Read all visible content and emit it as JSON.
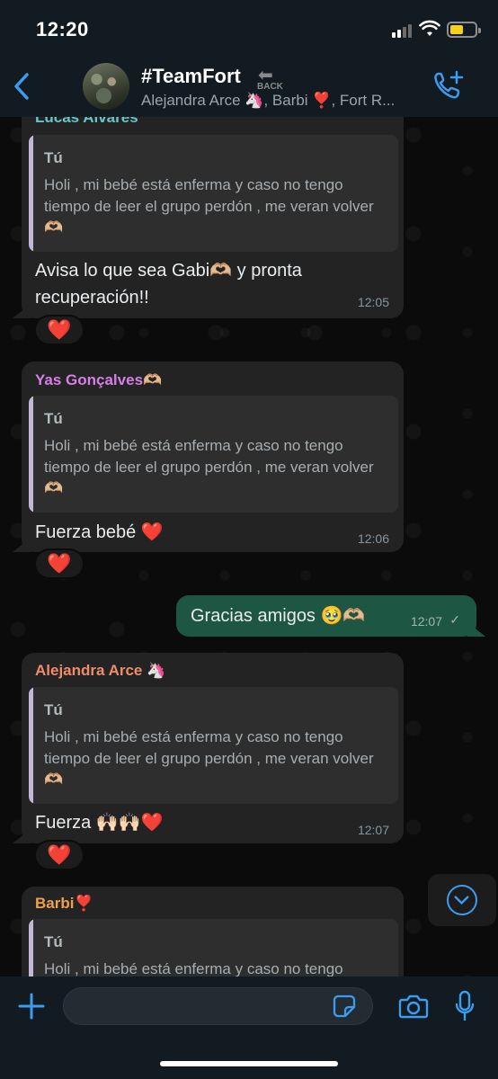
{
  "status_bar": {
    "time": "12:20"
  },
  "header": {
    "title": "#TeamFort",
    "back_badge": "BACK",
    "subtitle": "Alejandra Arce 🦄, Barbi ❣️, Fort R..."
  },
  "messages": [
    {
      "sender": "Lucas Alvares",
      "sender_color": "#68c5c6",
      "quote_author": "Tú",
      "quote_text": "Holi , mi bebé está enferma y caso no tengo tiempo de leer el grupo perdón , me veran volver 🫶🏼",
      "text": "Avisa lo que sea Gabi🫶🏼 y pronta recuperación!!",
      "time": "12:05",
      "reaction": "❤️"
    },
    {
      "sender": "Yas Gonçalves🫶🏼",
      "sender_color": "#d77ee6",
      "quote_author": "Tú",
      "quote_text": "Holi , mi bebé está enferma y caso no tengo tiempo de leer el grupo perdón , me veran volver 🫶🏼",
      "text": "Fuerza bebé ❤️",
      "time": "12:06",
      "reaction": "❤️"
    },
    {
      "outgoing": true,
      "text": "Gracias amigos 🥹🫶🏼",
      "time": "12:07",
      "status": "✓"
    },
    {
      "sender": "Alejandra Arce 🦄",
      "sender_color": "#f08c6a",
      "quote_author": "Tú",
      "quote_text": "Holi , mi bebé está enferma y caso no tengo tiempo de leer el grupo perdón , me veran volver 🫶🏼",
      "text": "Fuerza 🙌🏻🙌🏻❤️",
      "time": "12:07",
      "reaction": "❤️"
    },
    {
      "sender": "Barbi❣️",
      "sender_color": "#f0a04a",
      "quote_author": "Tú",
      "quote_text": "Holi , mi bebé está enferma y caso no tengo"
    }
  ]
}
